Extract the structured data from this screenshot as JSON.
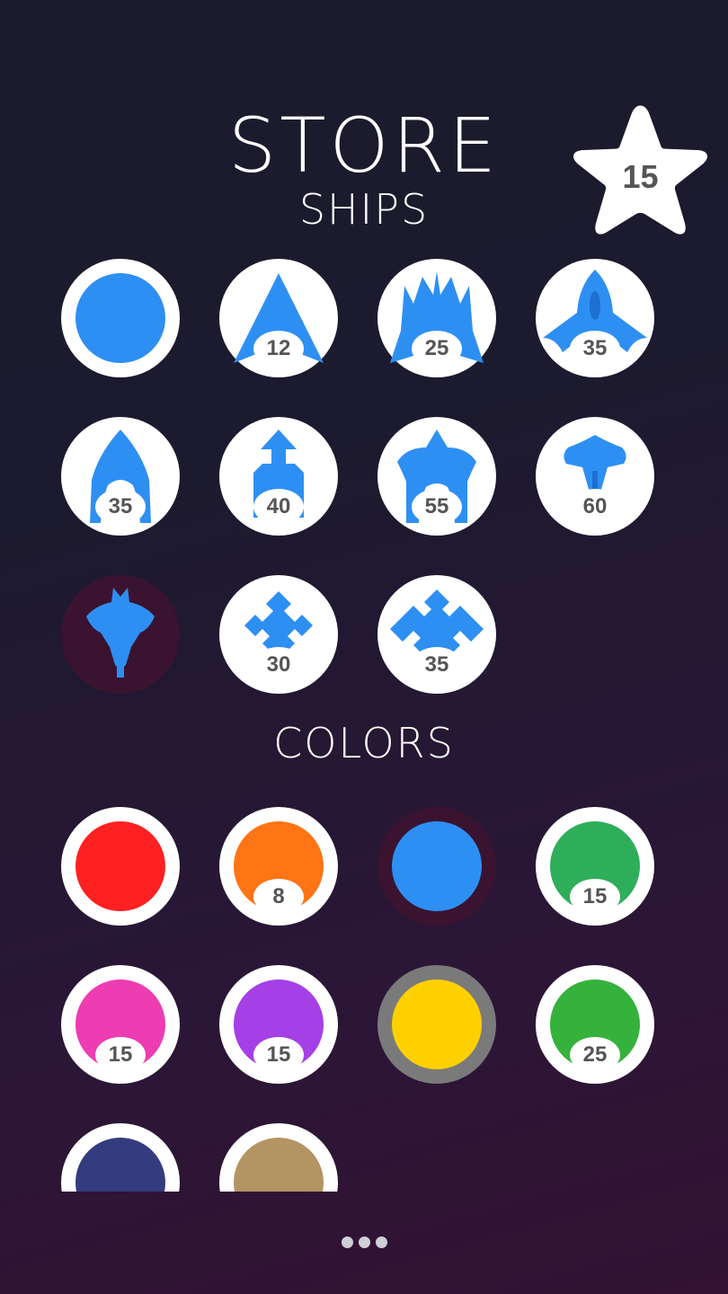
{
  "header": {
    "title": "STORE",
    "stars": "15"
  },
  "sections": {
    "ships": "SHIPS",
    "colors": "COLORS"
  },
  "ships": [
    {
      "price": "",
      "icon": "round-ship-icon"
    },
    {
      "price": "12",
      "icon": "arrow-ship-icon"
    },
    {
      "price": "25",
      "icon": "spike-ship-icon"
    },
    {
      "price": "35",
      "icon": "wing-ship-icon"
    },
    {
      "price": "35",
      "icon": "hook-ship-icon"
    },
    {
      "price": "40",
      "icon": "rocket-ship-icon"
    },
    {
      "price": "55",
      "icon": "crown-ship-icon"
    },
    {
      "price": "60",
      "icon": "ray-ship-icon"
    },
    {
      "price": "",
      "icon": "manta-ship-icon",
      "selected": true
    },
    {
      "price": "30",
      "icon": "diamond-ship-icon"
    },
    {
      "price": "35",
      "icon": "cluster-ship-icon"
    }
  ],
  "colors": [
    {
      "price": "",
      "color": "#ff2121"
    },
    {
      "price": "8",
      "color": "#ff7414"
    },
    {
      "price": "",
      "color": "#2e8ff3",
      "selected": true
    },
    {
      "price": "15",
      "color": "#2fae5a"
    },
    {
      "price": "15",
      "color": "#ee3cb3"
    },
    {
      "price": "15",
      "color": "#a53fe6"
    },
    {
      "price": "",
      "color": "#ffd000",
      "selected": true
    },
    {
      "price": "25",
      "color": "#35b23b"
    },
    {
      "price": "",
      "color": "#343b7f"
    },
    {
      "price": "",
      "color": "#b49463"
    }
  ],
  "theme": {
    "ship_blue": "#2e8ff3"
  },
  "pager": {
    "dots": 3
  }
}
